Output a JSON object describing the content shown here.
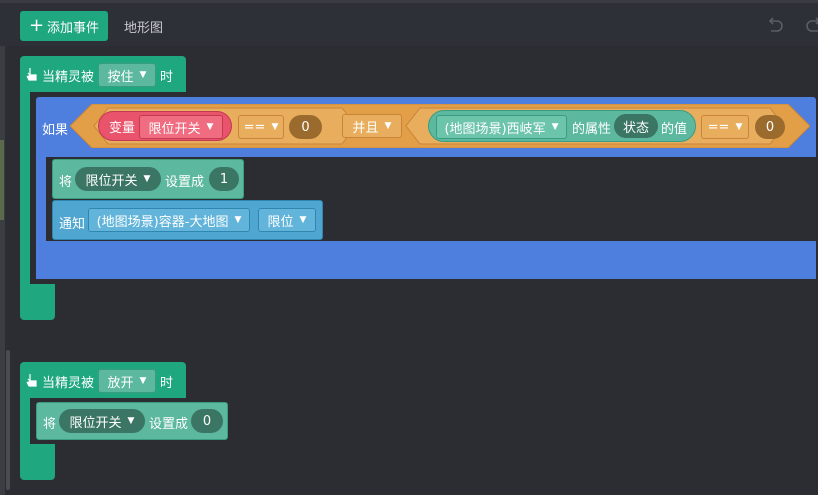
{
  "toolbar": {
    "add_event_label": "添加事件",
    "tab_label": "地形图",
    "undo_icon": "undo-icon",
    "redo_icon": "redo-icon"
  },
  "event1": {
    "prefix": "当精灵被",
    "trigger": "按住",
    "suffix": "时",
    "if_label": "如果",
    "cond1": {
      "var_label": "变量",
      "var_name": "限位开关",
      "op": "==",
      "value": "0"
    },
    "logic": "并且",
    "cond2": {
      "object": "(地图场景)西岐军",
      "prop_label": "的属性",
      "prop": "状态",
      "value_label": "的值",
      "op": "==",
      "value": "0"
    },
    "set": {
      "label": "将",
      "var": "限位开关",
      "set_label": "设置成",
      "value": "1"
    },
    "notify": {
      "label": "通知",
      "target": "(地图场景)容器-大地图",
      "message": "限位"
    }
  },
  "event2": {
    "prefix": "当精灵被",
    "trigger": "放开",
    "suffix": "时",
    "set": {
      "label": "将",
      "var": "限位开关",
      "set_label": "设置成",
      "value": "0"
    }
  },
  "colors": {
    "event_green": "#1fa780",
    "if_blue": "#4f7fde",
    "condition_orange": "#e29f47",
    "variable_red": "#e9536b",
    "action_teal": "#5cb89e",
    "notify_sky": "#4fa6d0"
  }
}
